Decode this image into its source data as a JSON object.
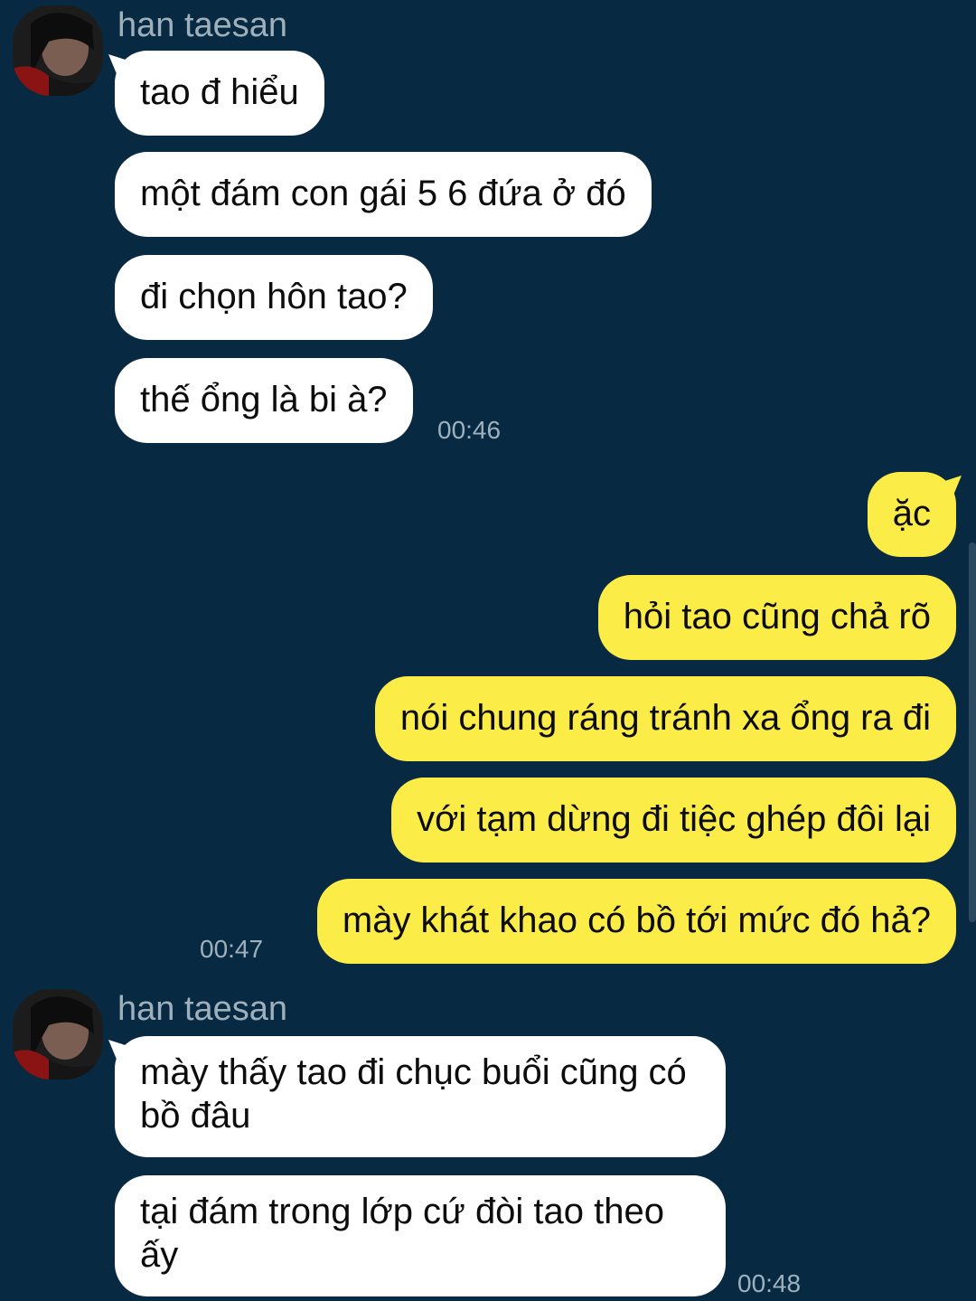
{
  "chat": {
    "groups": [
      {
        "sender": "han taesan",
        "avatar_icon": "profile-photo",
        "messages": [
          "tao đ hiểu",
          "một đám con gái 5 6 đứa ở đó",
          "đi chọn hôn tao?",
          "thế ổng là bi à?"
        ],
        "time": "00:46"
      },
      {
        "sender": "",
        "messages": [
          "ặc",
          "hỏi tao cũng chả rõ",
          "nói chung ráng tránh xa ổng ra đi",
          "với tạm dừng đi tiệc ghép đôi lại",
          "mày khát khao có bồ tới mức đó hả?"
        ],
        "time": "00:47"
      },
      {
        "sender": "han taesan",
        "avatar_icon": "profile-photo",
        "messages": [
          "mày thấy tao đi chục buổi cũng có bồ đâu",
          "tại đám trong lớp cứ đòi tao theo ấy"
        ],
        "time": "00:48"
      }
    ]
  },
  "colors": {
    "background": "#072a42",
    "incoming_bubble": "#ffffff",
    "outgoing_bubble": "#fbec47",
    "meta_text": "#9fb0bd"
  }
}
